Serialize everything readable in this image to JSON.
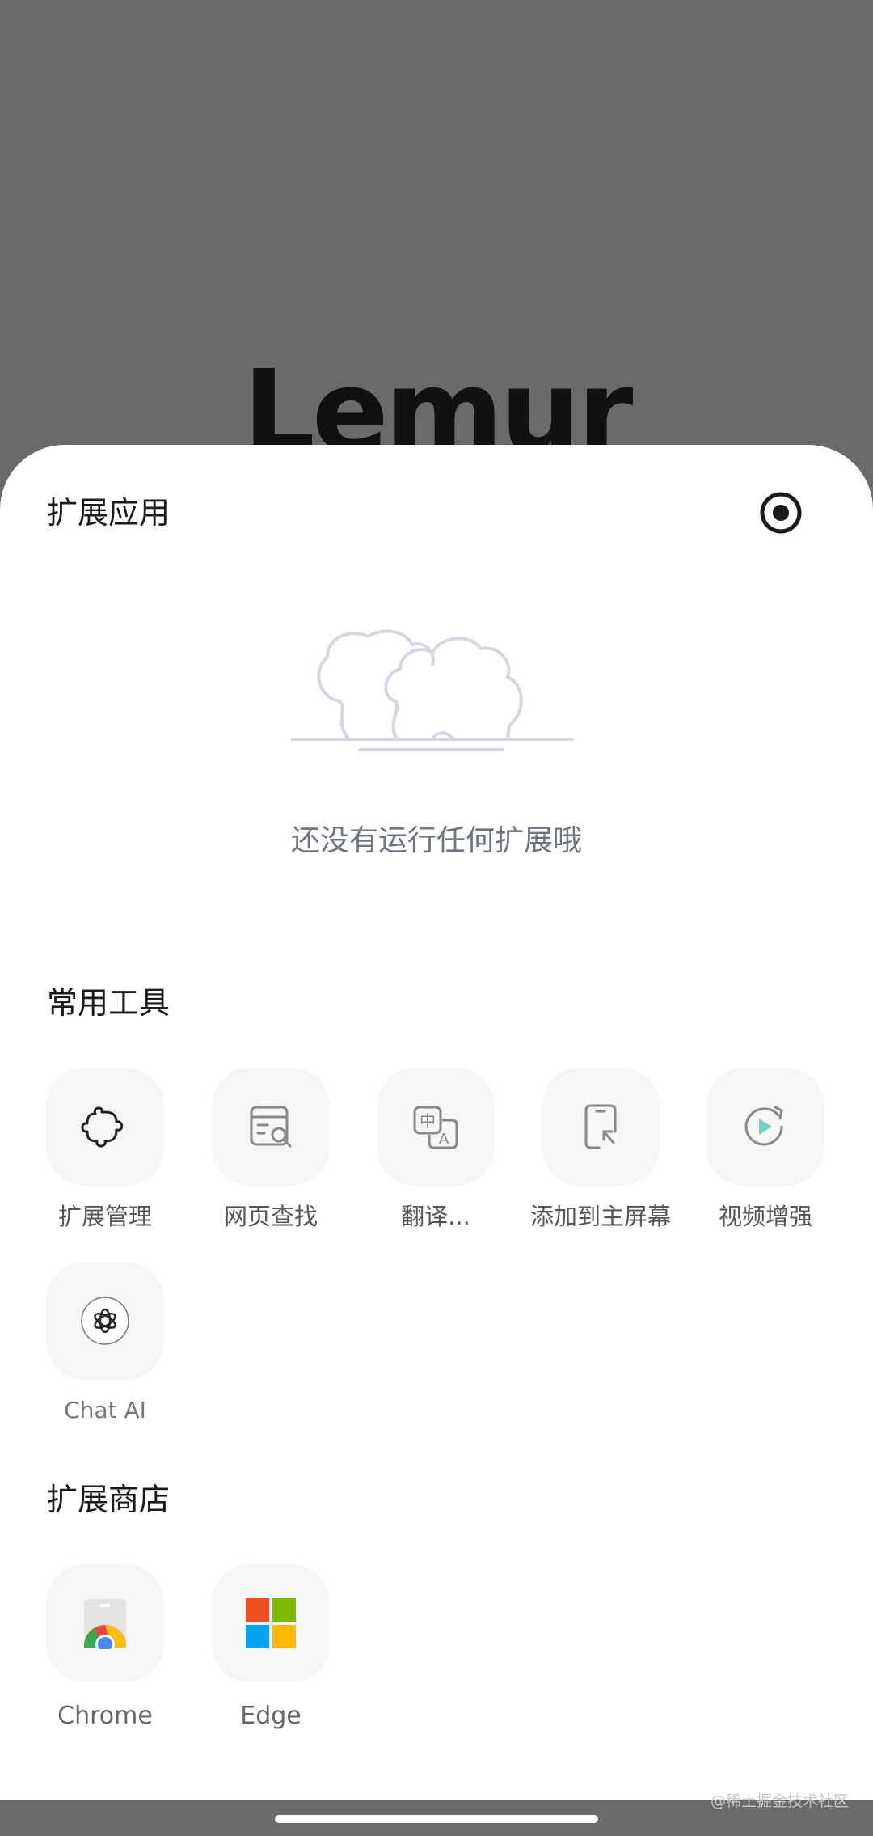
{
  "background_app": {
    "logo_text": "Lemur"
  },
  "sheet": {
    "title": "扩展应用",
    "record_icon": "record-icon",
    "empty_state": {
      "icon": "cloud-trees-icon",
      "text": "还没有运行任何扩展哦"
    }
  },
  "tools": {
    "title": "常用工具",
    "items": [
      {
        "label": "扩展管理",
        "icon": "puzzle-icon"
      },
      {
        "label": "网页查找",
        "icon": "web-search-icon"
      },
      {
        "label": "翻译...",
        "icon": "translate-icon"
      },
      {
        "label": "添加到主屏幕",
        "icon": "add-to-home-icon"
      },
      {
        "label": "视频增强",
        "icon": "video-enhance-icon"
      },
      {
        "label": "Chat AI",
        "icon": "chat-ai-icon"
      }
    ]
  },
  "store": {
    "title": "扩展商店",
    "items": [
      {
        "label": "Chrome",
        "icon": "chrome-store-icon"
      },
      {
        "label": "Edge",
        "icon": "edge-store-icon"
      }
    ]
  },
  "watermark": "@稀土掘金技术社区",
  "colors": {
    "backdrop": "#6a6a6a",
    "sheet": "#ffffff",
    "tile": "#f6f6f6",
    "illustration": "#d4d7e3",
    "accent_teal": "#6fd3c4"
  }
}
